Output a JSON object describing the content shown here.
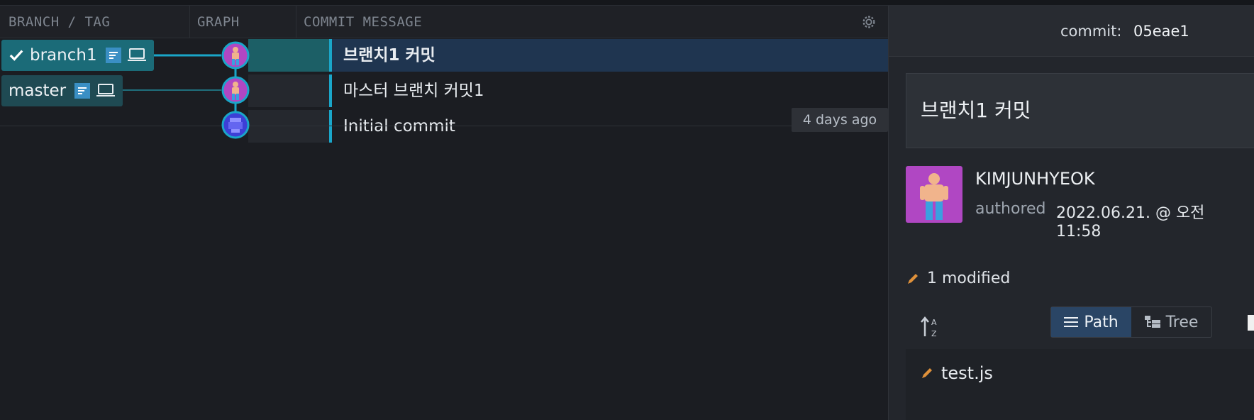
{
  "columns": {
    "branch_tag": "BRANCH / TAG",
    "graph": "GRAPH",
    "commit_message": "COMMIT MESSAGE"
  },
  "branches": [
    {
      "name": "branch1",
      "checked_out": true
    },
    {
      "name": "master",
      "checked_out": false
    }
  ],
  "commits": [
    {
      "message": "브랜치1 커밋",
      "selected": true
    },
    {
      "message": "마스터 브랜치 커밋1",
      "selected": false
    },
    {
      "message": "Initial commit",
      "selected": false
    }
  ],
  "tooltip": "4 days ago",
  "detail": {
    "commit_label": "commit:",
    "sha": "05eae1",
    "summary": "브랜치1 커밋",
    "author": "KIMJUNHYEOK",
    "authored_label": "authored",
    "authored_date": "2022.06.21. @ 오전 11:58",
    "modified_summary": "1 modified",
    "view_path": "Path",
    "view_tree": "Tree",
    "files": [
      "test.js"
    ]
  },
  "colors": {
    "accent": "#1aa6c9",
    "active_branch": "#1b6b78",
    "selected_row": "#1f3550",
    "avatar_bg": "#b047c3",
    "pencil": "#e0913a"
  },
  "icons": [
    "check-icon",
    "branch-remote-icon",
    "laptop-icon",
    "settings-icon",
    "pencil-icon",
    "sort-az-icon",
    "list-icon",
    "tree-icon",
    "avatar-icon"
  ]
}
